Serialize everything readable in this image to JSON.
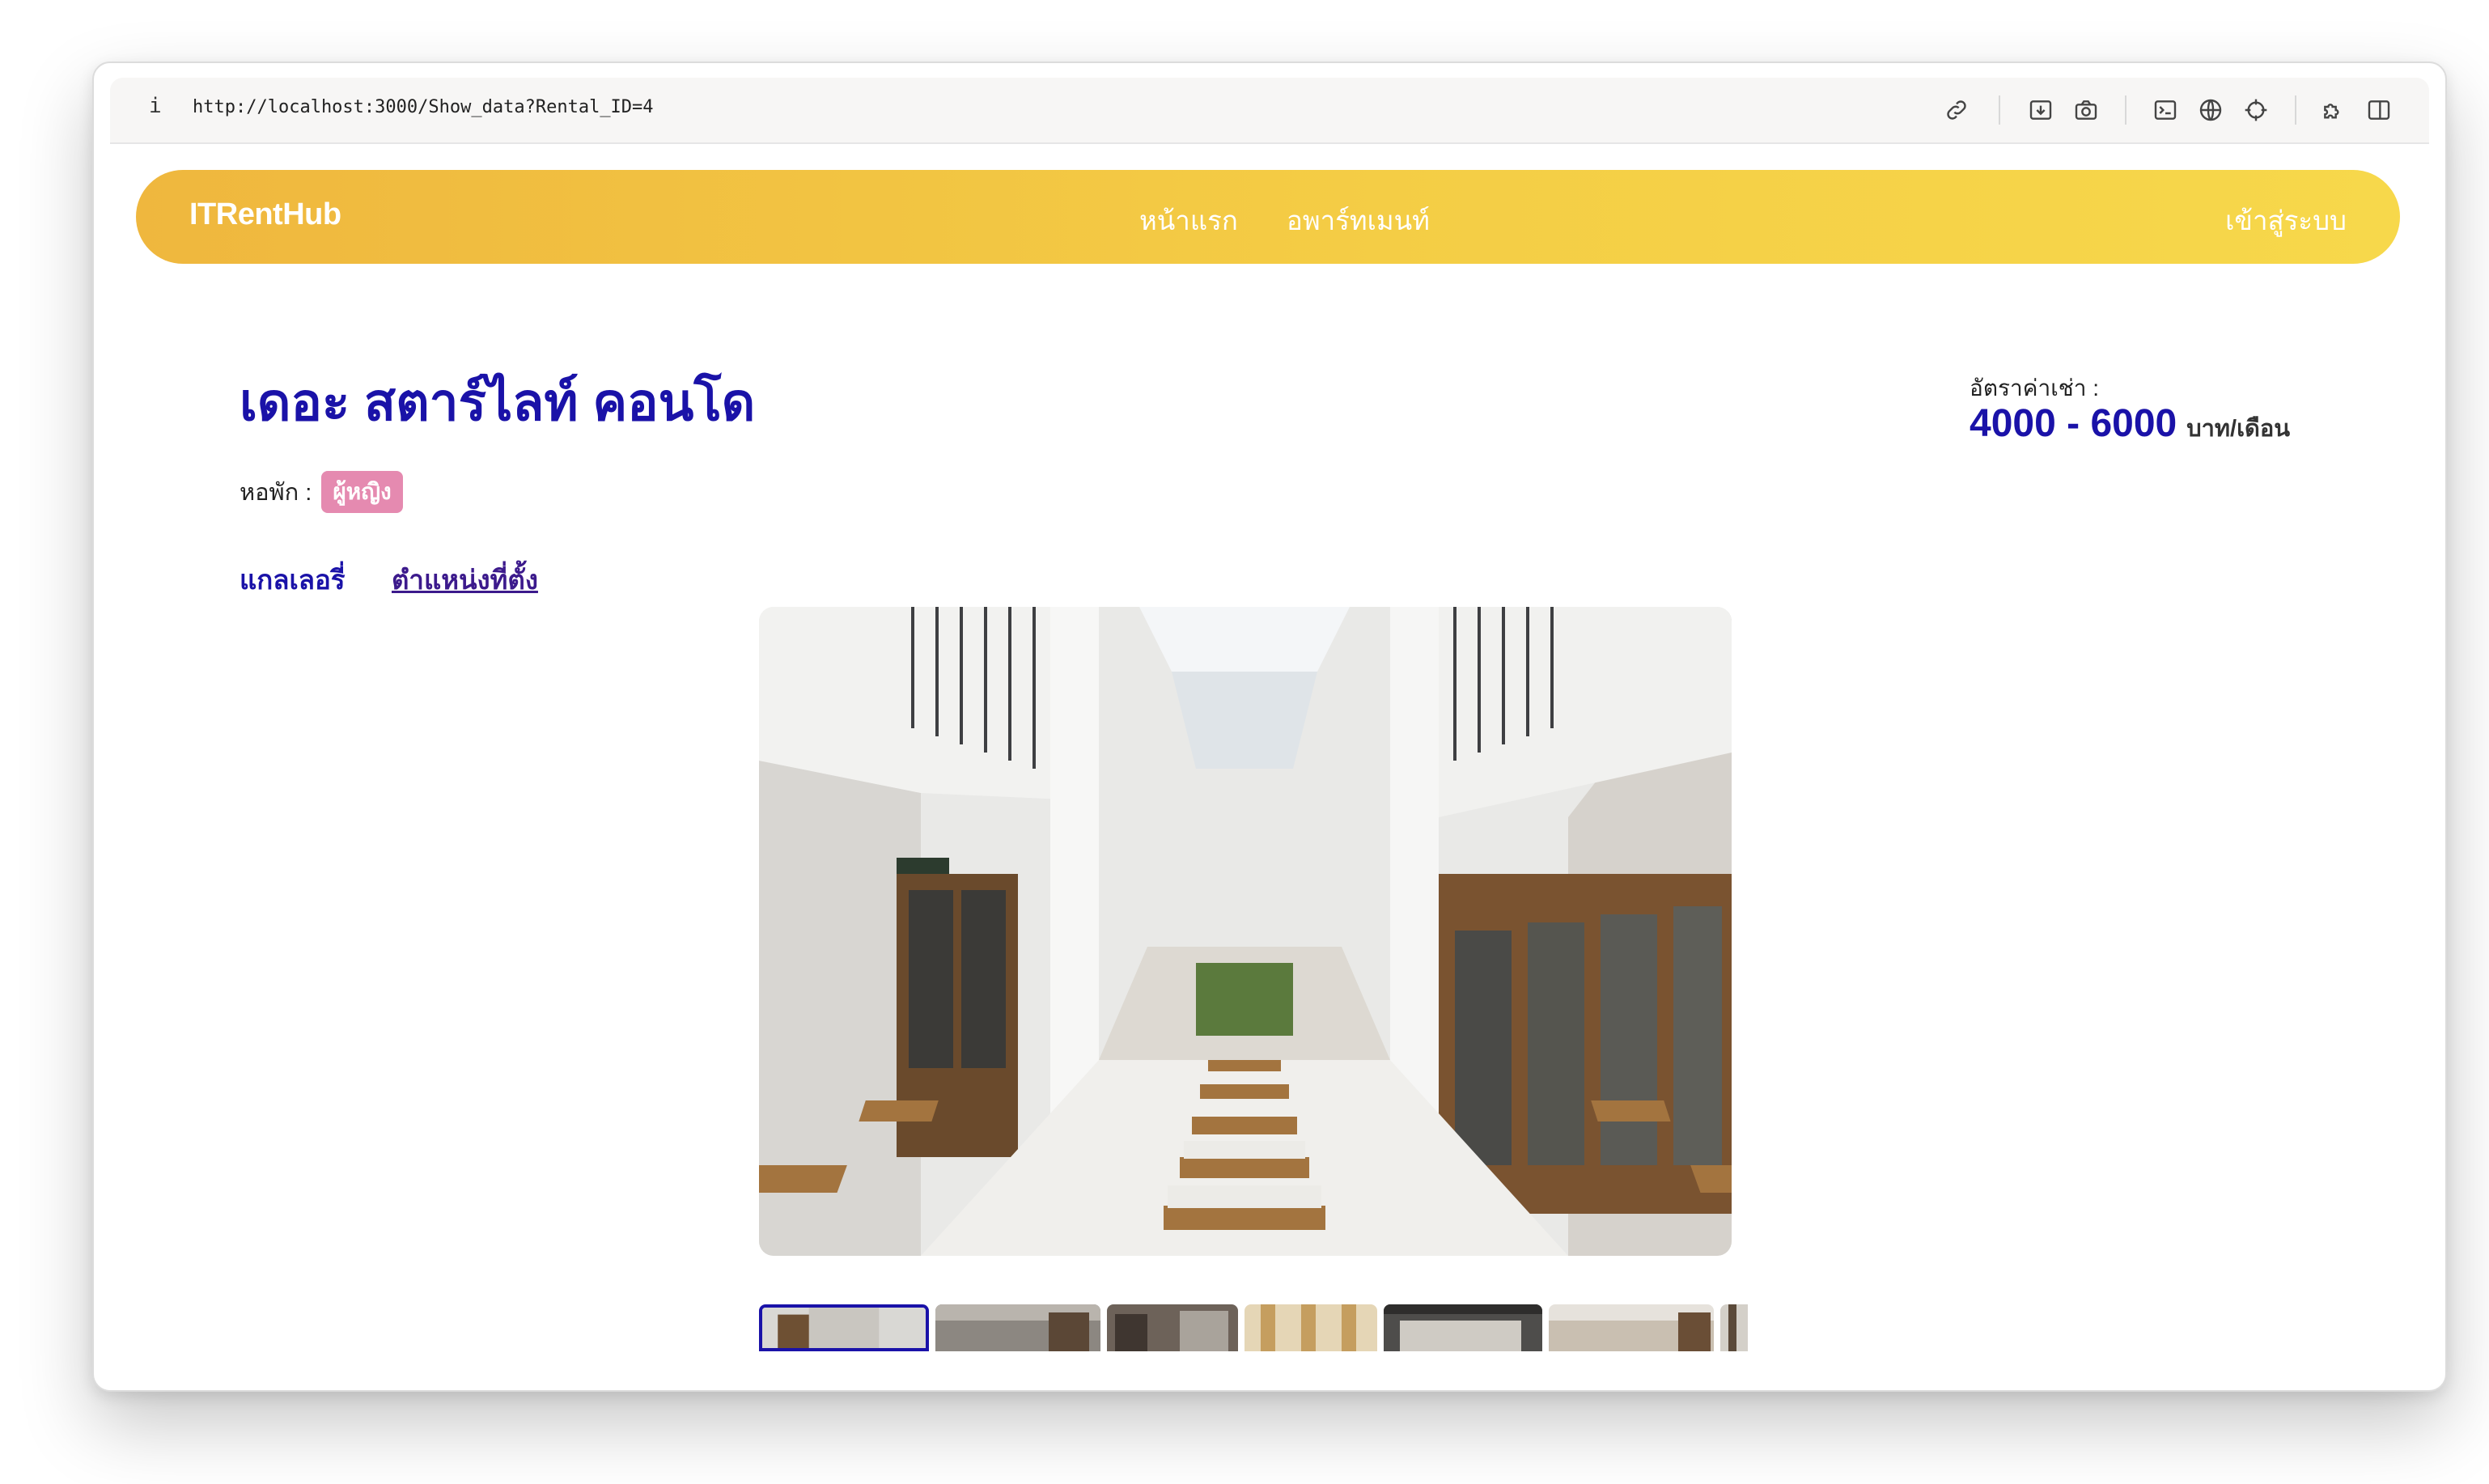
{
  "browser": {
    "info_glyph": "i",
    "url": "http://localhost:3000/Show_data?Rental_ID=4",
    "tools": [
      "link-icon",
      "download-icon",
      "camera-icon",
      "terminal-icon",
      "globe-icon",
      "crosshair-icon",
      "extensions-icon",
      "sidebar-icon"
    ]
  },
  "navbar": {
    "brand": "ITRentHub",
    "links": [
      "หน้าแรก",
      "อพาร์ทเมนท์"
    ],
    "login": "เข้าสู่ระบบ",
    "gradient": [
      "#efb73e",
      "#f7d84b"
    ]
  },
  "listing": {
    "title": "เดอะ สตาร์ไลท์ คอนโด",
    "type_label": "หอพัก :",
    "type_badge": "ผู้หญิง",
    "tabs": {
      "gallery": "แกลเลอรี่",
      "location": "ตำแหน่งที่ตั้ง"
    },
    "price_label": "อัตราค่าเช่า :",
    "price_value": "4000 - 6000",
    "price_unit": "บาท/เดือน"
  },
  "gallery": {
    "main_image": "apartment-corridor-photo",
    "thumbnails": [
      {
        "name": "thumbnail-1",
        "active": true
      },
      {
        "name": "thumbnail-2",
        "active": false
      },
      {
        "name": "thumbnail-3",
        "active": false
      },
      {
        "name": "thumbnail-4",
        "active": false
      },
      {
        "name": "thumbnail-5",
        "active": false
      },
      {
        "name": "thumbnail-6",
        "active": false
      },
      {
        "name": "thumbnail-7",
        "active": false
      }
    ]
  },
  "colors": {
    "accent_blue": "#1a12a8",
    "badge_pink": "#e58ab0",
    "location_link": "#3c1a8c"
  }
}
